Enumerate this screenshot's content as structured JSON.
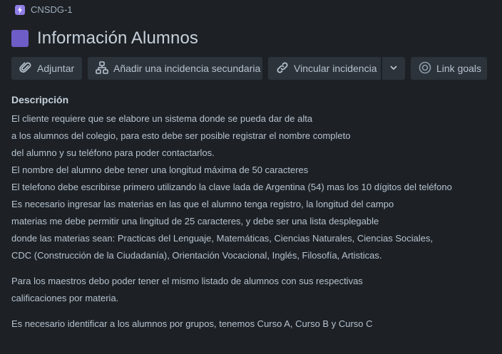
{
  "breadcrumb": {
    "issue_key": "CNSDG-1"
  },
  "issue": {
    "title": "Información Alumnos"
  },
  "toolbar": {
    "attach_label": "Adjuntar",
    "add_child_label": "Añadir una incidencia secundaria",
    "link_issue_label": "Vincular incidencia",
    "link_goals_label": "Link goals"
  },
  "description": {
    "heading": "Descripción",
    "paragraph1": [
      "El cliente requiere que se elabore un sistema donde se pueda dar de alta",
      "a los alumnos del colegio, para esto debe ser posible registrar el nombre completo",
      "del alumno y su teléfono para poder contactarlos.",
      "El nombre del alumno debe tener una longitud máxima de 50 caracteres",
      "El telefono debe escribirse primero utilizando la clave lada de Argentina  (54) mas los 10 dígitos del teléfono",
      "Es necesario ingresar las materias en las que el alumno tenga registro, la longitud del campo",
      "materias me debe permitir una lingitud de 25 caracteres, y debe ser una lista desplegable",
      "donde las materias sean:  Practicas del Lenguaje, Matemáticas, Ciencias Naturales, Ciencias Sociales,",
      "CDC (Construcción de la Ciudadanía), Orientación Vocacional, Inglés, Filosofía, Artisticas."
    ],
    "paragraph2": [
      "Para los maestros debo poder tener el mismo listado de alumnos con sus respectivas",
      "calificaciones por materia."
    ],
    "paragraph3": [
      "Es necesario identificar a los alumnos por grupos, tenemos Curso A, Curso B y Curso C"
    ]
  },
  "colors": {
    "background": "#1d2125",
    "button_bg": "#2c333a",
    "issue_type": "#6e5dc6",
    "epic_icon": "#8f7ee7"
  },
  "icons": {
    "breadcrumb": "bolt-icon",
    "attach": "paperclip-icon",
    "add_child": "hierarchy-icon",
    "link": "link-icon",
    "dropdown": "chevron-down-icon",
    "goals": "target-icon"
  }
}
